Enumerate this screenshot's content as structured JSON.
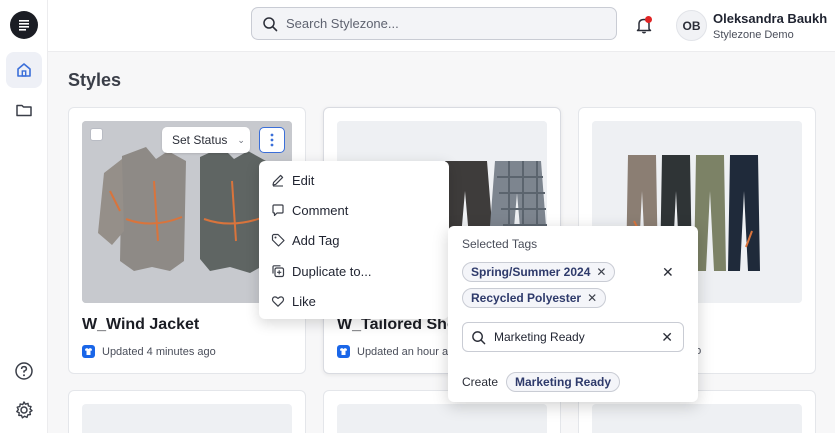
{
  "search": {
    "placeholder": "Search Stylezone..."
  },
  "user": {
    "initials": "OB",
    "name": "Oleksandra Baukh",
    "org": "Stylezone Demo"
  },
  "page": {
    "title": "Styles"
  },
  "cards": [
    {
      "title": "W_Wind Jacket",
      "updated": "Updated 4 minutes ago"
    },
    {
      "title": "W_Tailored Sho",
      "updated": "Updated an hour ag"
    },
    {
      "title": "",
      "updated": "go"
    }
  ],
  "card_overlay": {
    "set_status_label": "Set Status"
  },
  "context_menu": {
    "items": [
      "Edit",
      "Comment",
      "Add Tag",
      "Duplicate to...",
      "Like"
    ]
  },
  "tag_popover": {
    "title": "Selected Tags",
    "selected_tags": [
      "Spring/Summer 2024",
      "Recycled Polyester"
    ],
    "input_value": "Marketing Ready",
    "create_label": "Create",
    "create_tag": "Marketing Ready"
  },
  "colors": {
    "accent": "#1a66e8",
    "notification": "#e02424",
    "tag_text": "#2e3a6b"
  }
}
